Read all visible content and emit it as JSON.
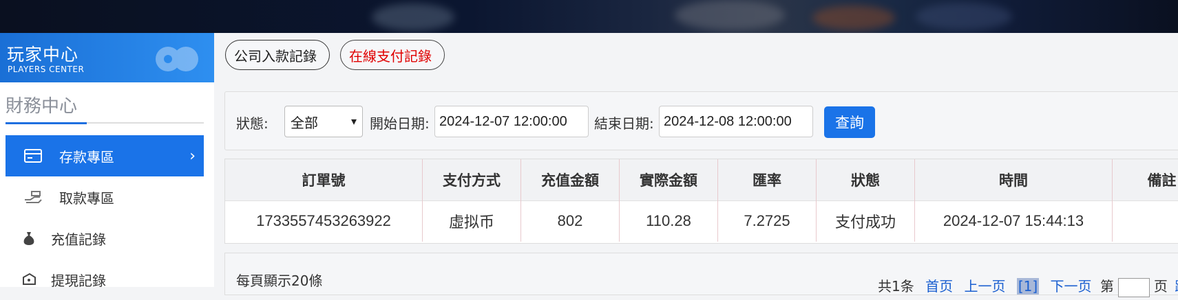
{
  "sidebar": {
    "header_title": "玩家中心",
    "header_sub": "PLAYERS CENTER",
    "section_title": "財務中心",
    "items": [
      {
        "label": "存款專區",
        "icon": "card-icon",
        "active": true
      },
      {
        "label": "取款專區",
        "icon": "hand-money-icon",
        "active": false
      },
      {
        "label": "充值記錄",
        "icon": "money-bag-icon",
        "active": false
      },
      {
        "label": "提現記錄",
        "icon": "tag-money-icon",
        "active": false
      }
    ]
  },
  "tabs": [
    {
      "label": "公司入款記錄"
    },
    {
      "label": "在線支付記錄"
    }
  ],
  "filter": {
    "status_label": "狀態:",
    "status_value": "全部",
    "start_label": "開始日期:",
    "start_value": "2024-12-07 12:00:00",
    "end_label": "結束日期:",
    "end_value": "2024-12-08 12:00:00",
    "query_button": "查詢"
  },
  "table": {
    "headers": [
      "訂單號",
      "支付方式",
      "充值金額",
      "實際金額",
      "匯率",
      "狀態",
      "時間",
      "備註"
    ],
    "rows": [
      [
        "1733557453263922",
        "虛拟币",
        "802",
        "110.28",
        "7.2725",
        "支付成功",
        "2024-12-07 15:44:13",
        ""
      ]
    ]
  },
  "pager": {
    "per_page": "每頁顯示20條",
    "total": "共1条",
    "first": "首页",
    "prev": "上一页",
    "current": "[1]",
    "next": "下一页",
    "page_prefix": "第",
    "page_suffix": "页",
    "jump": "跳"
  },
  "colors": {
    "accent": "#1a73e8",
    "active_tab_text": "#e00000"
  }
}
